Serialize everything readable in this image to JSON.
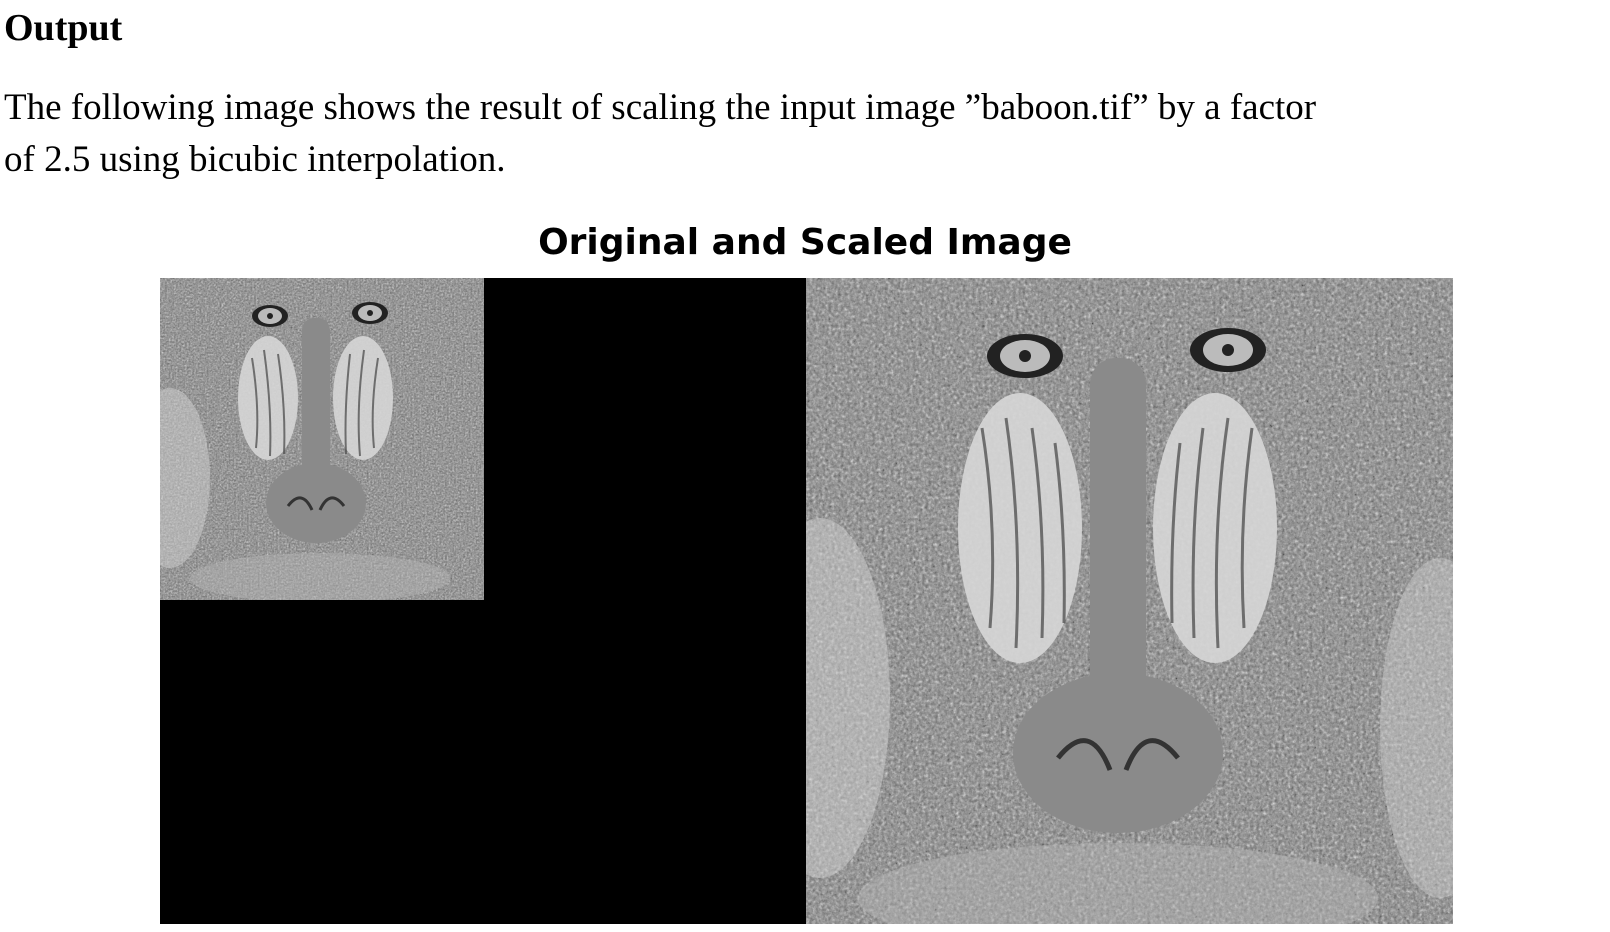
{
  "section": {
    "heading": "Output"
  },
  "paragraph": {
    "line1": "The following image shows the result of scaling the input image ”baboon.tif” by a factor",
    "line2": "of 2.5 using bicubic interpolation."
  },
  "figure": {
    "title": "Original and Scaled Image",
    "panels": [
      {
        "name": "original",
        "tone": "grayscale"
      },
      {
        "name": "scaled",
        "tone": "grayscale"
      }
    ],
    "background_color": "#000000"
  }
}
